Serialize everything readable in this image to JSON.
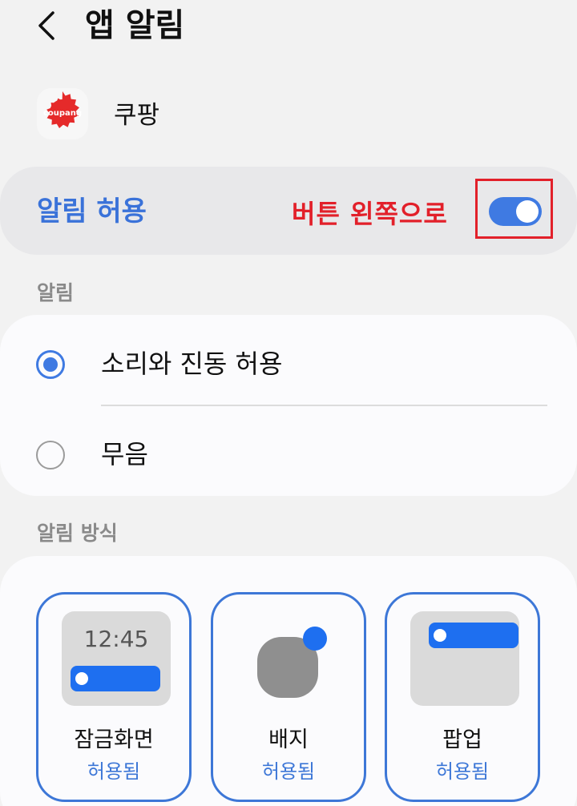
{
  "header": {
    "title": "앱 알림",
    "back_icon": "chevron-left-icon"
  },
  "app": {
    "name": "쿠팡",
    "icon_text": "coupang",
    "icon_color": "#e52a2a"
  },
  "allow": {
    "label": "알림 허용",
    "toggle_on": true,
    "annotation": "버튼 왼쪽으로",
    "annotation_color": "#e2202a",
    "accent_color": "#3f7ae2"
  },
  "alerts_section": {
    "label": "알림",
    "options": [
      {
        "label": "소리와 진동 허용",
        "selected": true
      },
      {
        "label": "무음",
        "selected": false
      }
    ]
  },
  "style_section": {
    "label": "알림 방식",
    "tiles": [
      {
        "name": "잠금화면",
        "status": "허용됨",
        "preview_time": "12:45",
        "icon": "lock-screen-preview-icon"
      },
      {
        "name": "배지",
        "status": "허용됨",
        "icon": "badge-preview-icon"
      },
      {
        "name": "팝업",
        "status": "허용됨",
        "icon": "popup-preview-icon"
      }
    ]
  }
}
